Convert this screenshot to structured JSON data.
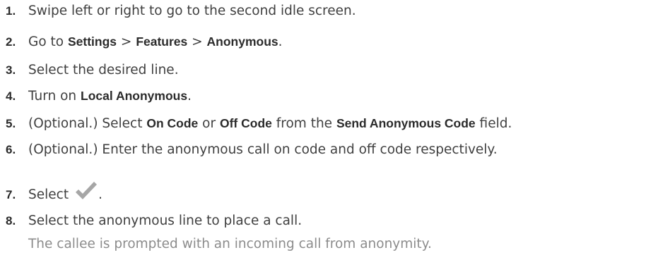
{
  "steps": [
    {
      "num": "1.",
      "parts": [
        "Swipe left or right to go to the second idle screen."
      ]
    },
    {
      "num": "2.",
      "parts": [
        "Go to ",
        "Settings",
        " > ",
        "Features",
        " > ",
        "Anonymous",
        "."
      ]
    },
    {
      "num": "3.",
      "parts": [
        "Select the desired line."
      ]
    },
    {
      "num": "4.",
      "parts": [
        "Turn on ",
        "Local Anonymous",
        "."
      ]
    },
    {
      "num": "5.",
      "parts": [
        "(Optional.) Select ",
        "On Code",
        " or ",
        "Off Code",
        " from the ",
        "Send Anonymous Code",
        " field."
      ]
    },
    {
      "num": "6.",
      "parts": [
        "(Optional.) Enter the anonymous call on code and off code respectively."
      ]
    },
    {
      "num": "7.",
      "parts": [
        "Select",
        "."
      ],
      "icon": "checkmark-icon"
    },
    {
      "num": "8.",
      "parts": [
        "Select the anonymous line to place a call."
      ],
      "result": "The callee is prompted with an incoming call from anonymity."
    }
  ],
  "colors": {
    "text": "#404040",
    "bold": "#2b2b2b",
    "result": "#8c8c8c",
    "check": "#a6a6a6"
  }
}
